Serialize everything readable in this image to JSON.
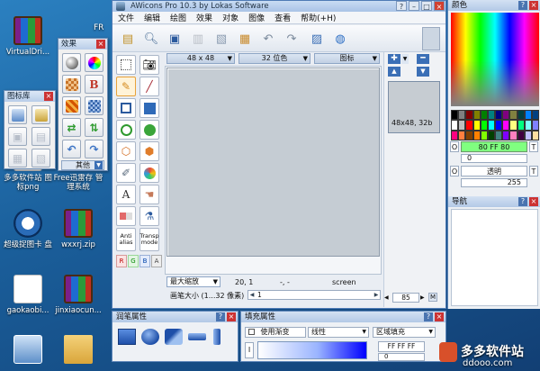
{
  "desktop": {
    "icons": [
      {
        "label": "VirtualDri...",
        "kind": "winrar"
      },
      {
        "label": "多多软件站 图标png",
        "kind": "doc"
      },
      {
        "label": "Free迅雷存 管理系统",
        "kind": "doc"
      },
      {
        "label": "超级捉图卡 盘",
        "kind": "tool"
      },
      {
        "label": "wxxrj.zip",
        "kind": "winrar"
      },
      {
        "label": "gaokaobi...",
        "kind": "doc"
      },
      {
        "label": "jinxiaocun...",
        "kind": "winrar"
      },
      {
        "label": "",
        "kind": "shot"
      },
      {
        "label": "",
        "kind": "folder"
      }
    ],
    "top_right_label": "FR"
  },
  "effects_panel": {
    "title": "效果",
    "footer": "其他",
    "buttons": [
      "sphere-effect-icon",
      "rainbow-effect-icon",
      "checker-effect-icon",
      "B",
      "pixel-effect-icon",
      "grid-effect-icon",
      "arrows-green-icon",
      "swap-arrows-icon",
      "undo-blue-icon",
      "redo-blue-icon"
    ]
  },
  "icon_library_panel": {
    "title": "图标库"
  },
  "window": {
    "title": "AWicons Pro 10.3 by Lokas Software",
    "menu": [
      "文件",
      "编辑",
      "绘图",
      "效果",
      "对象",
      "图像",
      "查看",
      "帮助(+H)"
    ],
    "size_select": "48 x 48",
    "depth_select": "32 位色",
    "type_select": "图标",
    "thumbnail_caption": "48x48, 32b",
    "zoom_select": "最大缩放",
    "coords": "20, 1",
    "coords2": "-, -",
    "mode": "screen",
    "brush_label": "画笔大小 (1...32 像素)",
    "brush_value": "1",
    "zoom_value": "85",
    "zoom_max": "M",
    "anti_alias": "Anti alias",
    "transp_mode": "Transp mode",
    "channels": [
      "R",
      "G",
      "B",
      "A"
    ]
  },
  "color_panel": {
    "title": "颜色",
    "hex": "80 FF 80",
    "alpha_value": "0",
    "transparent_label": "透明",
    "opacity_value": "255",
    "o_label": "O",
    "t_label": "T",
    "accent": "#80ff80",
    "palette": [
      "#000000",
      "#808080",
      "#800000",
      "#808000",
      "#008000",
      "#008080",
      "#000080",
      "#800080",
      "#808040",
      "#004040",
      "#0080ff",
      "#004080",
      "#ffffff",
      "#c0c0c0",
      "#ff0000",
      "#ffff00",
      "#00ff00",
      "#00ffff",
      "#0000ff",
      "#ff00ff",
      "#ffff80",
      "#00ff80",
      "#80ffff",
      "#8080ff",
      "#ff0080",
      "#ff8040",
      "#804000",
      "#ff8000",
      "#80ff00",
      "#004000",
      "#408080",
      "#8000ff",
      "#ff80c0",
      "#400040",
      "#c0c0ff",
      "#ffe0a0"
    ]
  },
  "nav_panel": {
    "title": "导航"
  },
  "stroke_panel": {
    "title": "润笔属性"
  },
  "fill_panel": {
    "title": "填充属性",
    "gradient_check": "使用渐变",
    "gradient_type": "线性",
    "fill_mode": "区域填充",
    "hex": "FF FF FF",
    "hex_value": "0",
    "i_label": "I"
  },
  "watermark": {
    "brand": "多多软件站",
    "url": "ddooo.com"
  }
}
